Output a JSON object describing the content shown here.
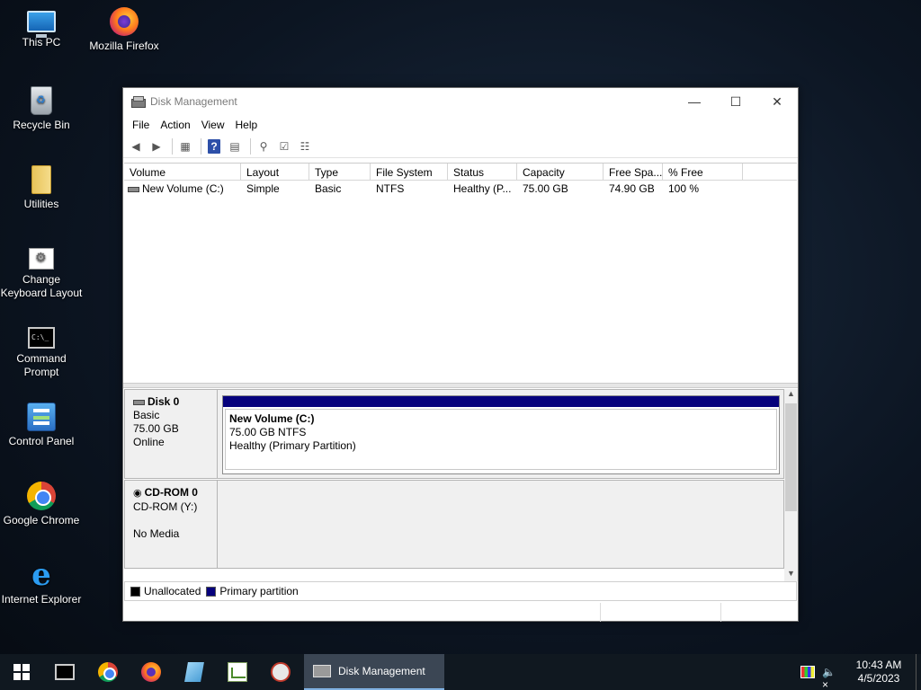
{
  "desktop": {
    "icons": [
      {
        "label": "This PC"
      },
      {
        "label": "Mozilla Firefox"
      },
      {
        "label": "Recycle Bin"
      },
      {
        "label": "Utilities"
      },
      {
        "label": "Change Keyboard Layout"
      },
      {
        "label": "Command Prompt"
      },
      {
        "label": "Control Panel"
      },
      {
        "label": "Google Chrome"
      },
      {
        "label": "Internet Explorer"
      }
    ]
  },
  "window": {
    "title": "Disk Management",
    "menu": [
      "File",
      "Action",
      "View",
      "Help"
    ]
  },
  "volumes": {
    "columns": [
      "Volume",
      "Layout",
      "Type",
      "File System",
      "Status",
      "Capacity",
      "Free Spa...",
      "% Free"
    ],
    "rows": [
      [
        "New Volume (C:)",
        "Simple",
        "Basic",
        "NTFS",
        "Healthy (P...",
        "75.00 GB",
        "74.90 GB",
        "100 %"
      ]
    ]
  },
  "disks": [
    {
      "name": "Disk 0",
      "lines": [
        "Basic",
        "75.00 GB",
        "Online"
      ],
      "partition": {
        "name": "New Volume  (C:)",
        "size_fs": "75.00 GB NTFS",
        "status": "Healthy (Primary Partition)"
      }
    },
    {
      "name": "CD-ROM 0",
      "lines": [
        "CD-ROM (Y:)",
        "",
        "No Media"
      ]
    }
  ],
  "legend": {
    "unallocated": "Unallocated",
    "primary": "Primary partition"
  },
  "taskbar": {
    "active_task": "Disk Management",
    "time": "10:43 AM",
    "date": "4/5/2023"
  },
  "colors": {
    "primary_partition": "#06017c",
    "unallocated": "#000000"
  }
}
